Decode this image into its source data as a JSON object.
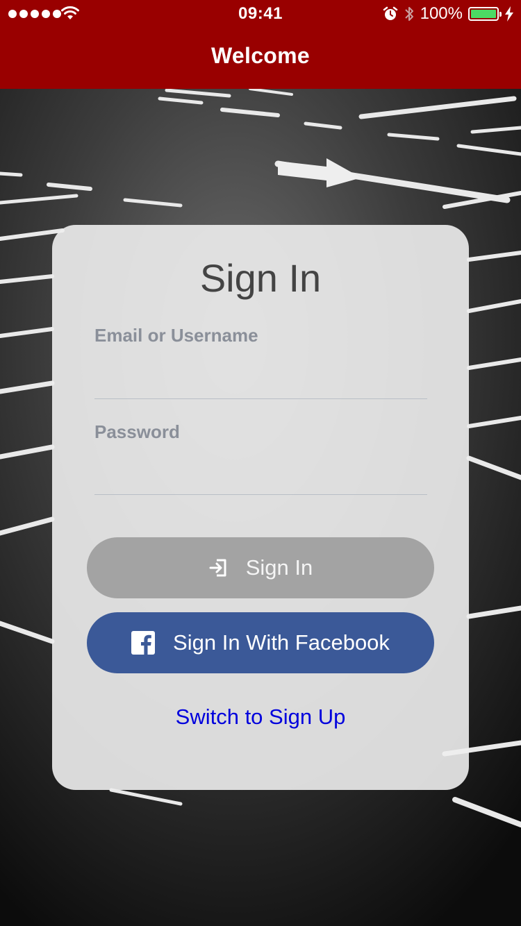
{
  "status_bar": {
    "time": "09:41",
    "battery_text": "100%",
    "signal_icon": "signal-dots-icon",
    "wifi_icon": "wifi-icon",
    "alarm_icon": "alarm-icon",
    "bluetooth_icon": "bluetooth-icon",
    "charging_icon": "charging-bolt-icon"
  },
  "nav": {
    "title": "Welcome",
    "bar_color": "#990000"
  },
  "form": {
    "title": "Sign In",
    "email_label": "Email or Username",
    "email_value": "",
    "password_label": "Password",
    "password_value": "",
    "signin_button": "Sign In",
    "signin_icon": "login-arrow-icon",
    "facebook_button": "Sign In With Facebook",
    "facebook_icon": "facebook-icon",
    "facebook_color": "#3b5998",
    "switch_link": "Switch to Sign Up",
    "link_color": "#0000dd"
  }
}
